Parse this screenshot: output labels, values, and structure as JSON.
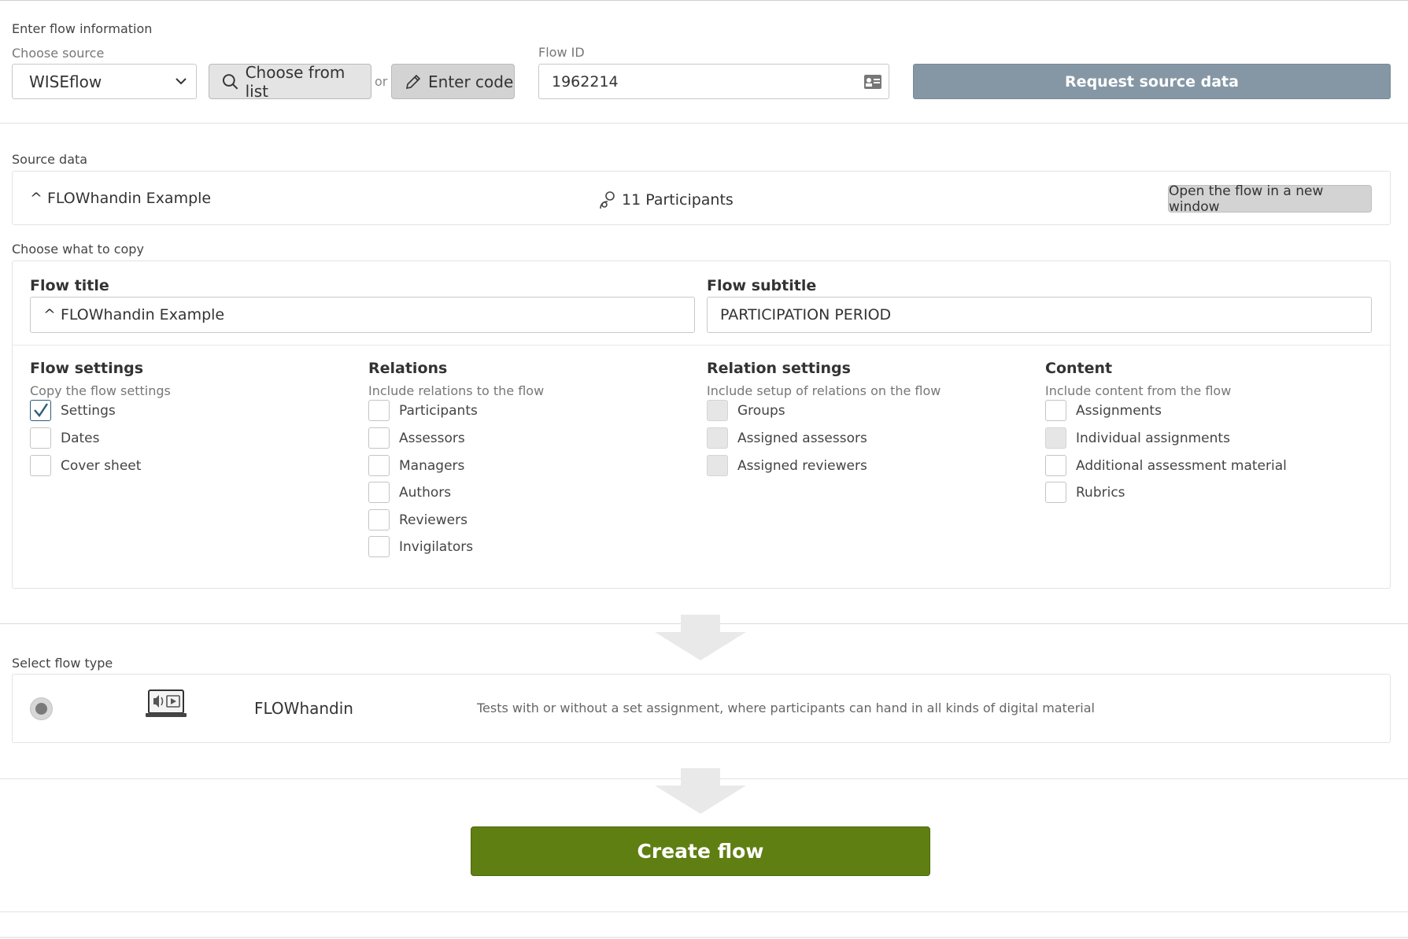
{
  "flow_info": {
    "section_label": "Enter flow information",
    "source_label": "Choose source",
    "source_value": "WISEflow",
    "choose_from_list": "Choose from list",
    "or_text": "or",
    "enter_code": "Enter code",
    "flow_id_label": "Flow ID",
    "flow_id_value": "1962214",
    "request_button": "Request source data"
  },
  "source_data": {
    "section_label": "Source data",
    "flow_name": "^ FLOWhandin Example",
    "participants": "11 Participants",
    "open_button": "Open the flow in a new window"
  },
  "copy": {
    "section_label": "Choose what to copy",
    "flow_title_label": "Flow title",
    "flow_title_value": "^ FLOWhandin Example",
    "flow_subtitle_label": "Flow subtitle",
    "flow_subtitle_value": "PARTICIPATION PERIOD",
    "columns": [
      {
        "title": "Flow settings",
        "subtitle": "Copy the flow settings",
        "items": [
          {
            "label": "Settings",
            "checked": true,
            "disabled": false
          },
          {
            "label": "Dates",
            "checked": false,
            "disabled": false
          },
          {
            "label": "Cover sheet",
            "checked": false,
            "disabled": false
          }
        ]
      },
      {
        "title": "Relations",
        "subtitle": "Include relations to the flow",
        "items": [
          {
            "label": "Participants",
            "checked": false,
            "disabled": false
          },
          {
            "label": "Assessors",
            "checked": false,
            "disabled": false
          },
          {
            "label": "Managers",
            "checked": false,
            "disabled": false
          },
          {
            "label": "Authors",
            "checked": false,
            "disabled": false
          },
          {
            "label": "Reviewers",
            "checked": false,
            "disabled": false
          },
          {
            "label": "Invigilators",
            "checked": false,
            "disabled": false
          }
        ]
      },
      {
        "title": "Relation settings",
        "subtitle": "Include setup of relations on the flow",
        "items": [
          {
            "label": "Groups",
            "checked": false,
            "disabled": true
          },
          {
            "label": "Assigned assessors",
            "checked": false,
            "disabled": true
          },
          {
            "label": "Assigned reviewers",
            "checked": false,
            "disabled": true
          }
        ]
      },
      {
        "title": "Content",
        "subtitle": "Include content from the flow",
        "items": [
          {
            "label": "Assignments",
            "checked": false,
            "disabled": false
          },
          {
            "label": "Individual assignments",
            "checked": false,
            "disabled": true
          },
          {
            "label": "Additional assessment material",
            "checked": false,
            "disabled": false
          },
          {
            "label": "Rubrics",
            "checked": false,
            "disabled": false
          }
        ]
      }
    ]
  },
  "flow_type": {
    "section_label": "Select flow type",
    "name": "FLOWhandin",
    "description": "Tests with or without a set assignment, where participants can hand in all kinds of digital material"
  },
  "create_button": "Create flow",
  "colors": {
    "request_button": "#8597a5",
    "create_button": "#5f7f12",
    "checkbox_checked": "#2d5d7b"
  }
}
